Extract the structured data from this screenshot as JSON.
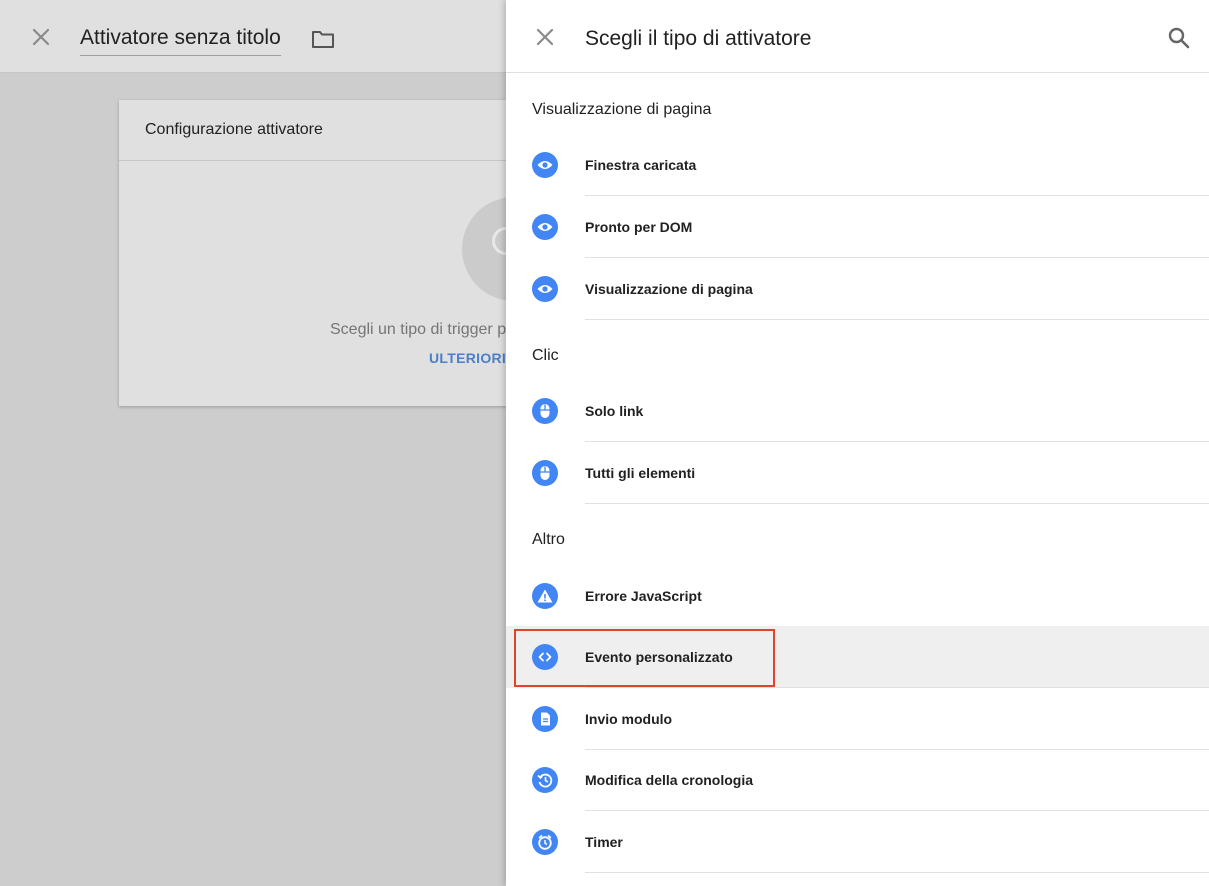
{
  "editor": {
    "title": "Attivatore senza titolo",
    "config": {
      "title": "Configurazione attivatore",
      "help_text": "Scegli un tipo di trigger p",
      "more_link": "ULTERIORI I"
    }
  },
  "panel": {
    "title": "Scegli il tipo di attivatore",
    "sections": [
      {
        "title": "Visualizzazione di pagina",
        "items": [
          {
            "label": "Finestra caricata",
            "icon": "eye-icon"
          },
          {
            "label": "Pronto per DOM",
            "icon": "eye-icon"
          },
          {
            "label": "Visualizzazione di pagina",
            "icon": "eye-icon"
          }
        ]
      },
      {
        "title": "Clic",
        "items": [
          {
            "label": "Solo link",
            "icon": "mouse-icon"
          },
          {
            "label": "Tutti gli elementi",
            "icon": "mouse-icon"
          }
        ]
      },
      {
        "title": "Altro",
        "items": [
          {
            "label": "Errore JavaScript",
            "icon": "warning-icon"
          },
          {
            "label": "Evento personalizzato",
            "icon": "code-icon",
            "selected": true
          },
          {
            "label": "Invio modulo",
            "icon": "document-icon"
          },
          {
            "label": "Modifica della cronologia",
            "icon": "history-icon"
          },
          {
            "label": "Timer",
            "icon": "alarm-icon"
          }
        ]
      }
    ]
  },
  "colors": {
    "accent": "#4285f4",
    "highlight_border": "#e0442f",
    "link": "#4a7fc9"
  }
}
